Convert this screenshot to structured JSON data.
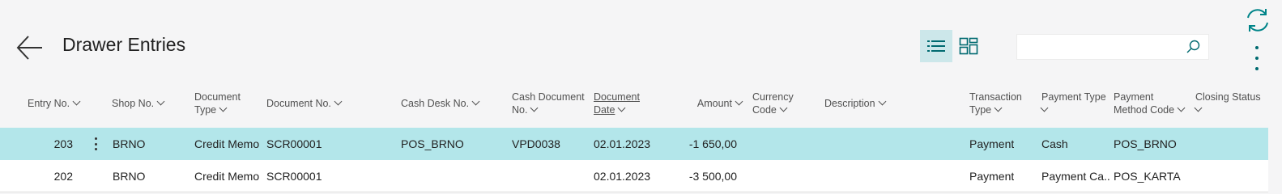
{
  "page": {
    "title": "Drawer Entries",
    "search": {
      "value": "",
      "placeholder": ""
    }
  },
  "icons": {
    "back": "arrow-left-icon",
    "list_view": "list-view-icon",
    "tile_view": "tile-view-icon",
    "search": "search-icon",
    "refresh": "refresh-icon",
    "more": "more-vertical-icon"
  },
  "colors": {
    "accent": "#008489",
    "selected_row": "#b3e6ea",
    "active_view": "#cce7ea"
  },
  "columns": {
    "entry_no": "Entry No.",
    "shop_no": "Shop No.",
    "document_type_1": "Document",
    "document_type_2": "Type",
    "document_no": "Document No.",
    "cash_desk_no": "Cash Desk No.",
    "cash_document_no_1": "Cash Document",
    "cash_document_no_2": "No.",
    "document_date_1": "Document",
    "document_date_2": "Date",
    "amount": "Amount",
    "currency_code_1": "Currency",
    "currency_code_2": "Code",
    "description": "Description",
    "transaction_type_1": "Transaction",
    "transaction_type_2": "Type",
    "payment_type": "Payment Type",
    "payment_method_code_1": "Payment",
    "payment_method_code_2": "Method Code",
    "closing_status": "Closing Status"
  },
  "rows": [
    {
      "entry_no": "203",
      "shop_no": "BRNO",
      "document_type": "Credit Memo",
      "document_no": "SCR00001",
      "cash_desk_no": "POS_BRNO",
      "cash_document_no": "VPD0038",
      "document_date": "02.01.2023",
      "amount": "-1 650,00",
      "currency_code": "",
      "description": "",
      "transaction_type": "Payment",
      "payment_type": "Cash",
      "payment_method_code": "POS_BRNO",
      "closing_status": ""
    },
    {
      "entry_no": "202",
      "shop_no": "BRNO",
      "document_type": "Credit Memo",
      "document_no": "SCR00001",
      "cash_desk_no": "",
      "cash_document_no": "",
      "document_date": "02.01.2023",
      "amount": "-3 500,00",
      "currency_code": "",
      "description": "",
      "transaction_type": "Payment",
      "payment_type": "Payment Ca...",
      "payment_method_code": "POS_KARTA",
      "closing_status": ""
    }
  ]
}
